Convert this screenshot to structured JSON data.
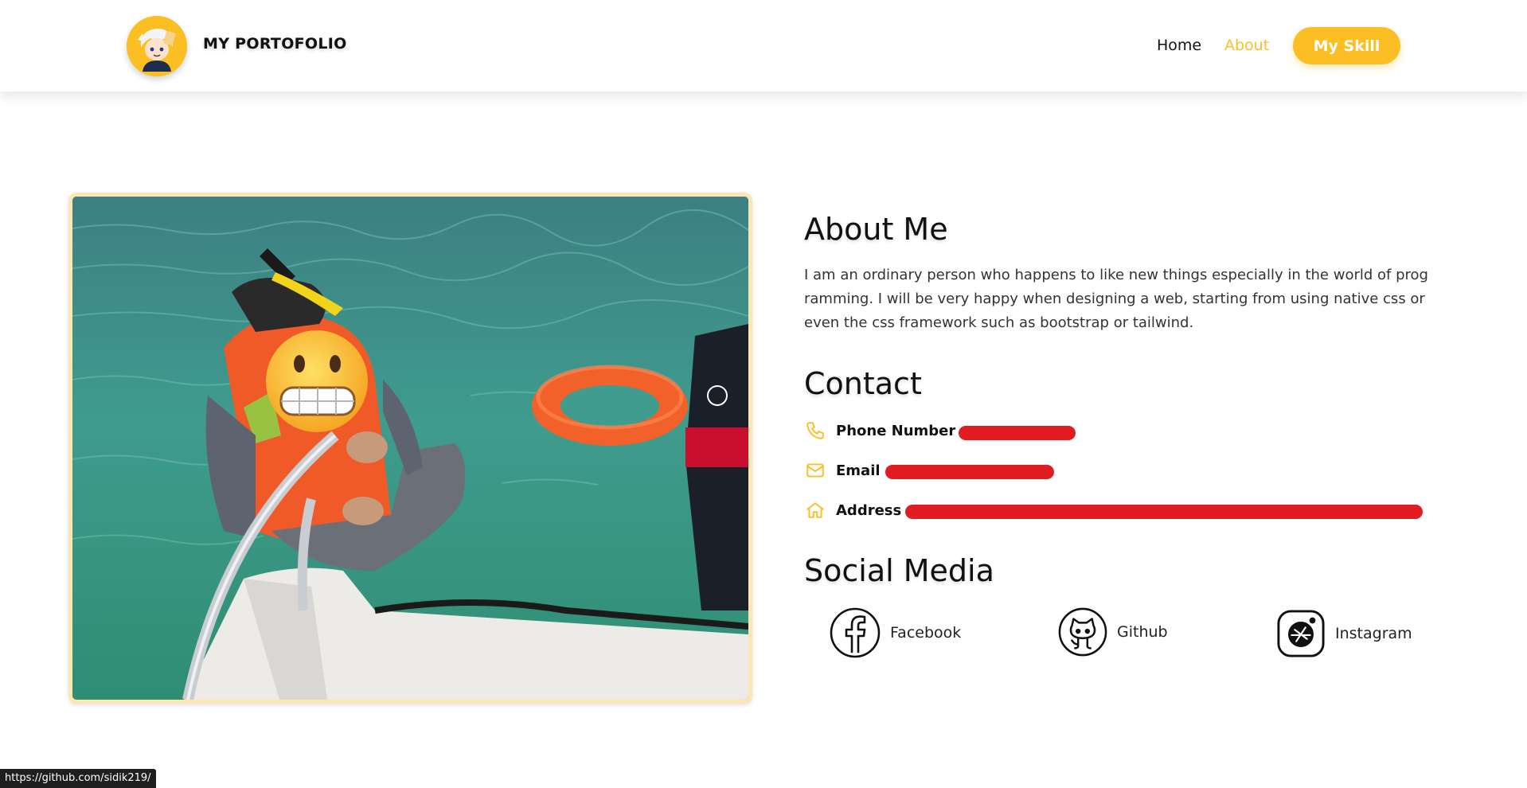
{
  "header": {
    "brand_title": "MY PORTOFOLIO",
    "logo_icon": "anime-character-avatar",
    "nav": {
      "home": "Home",
      "about": "About",
      "skill": "My Skill"
    },
    "active_nav": "About"
  },
  "about": {
    "heading": "About Me",
    "text": "I am an ordinary person who happens to like new things especially in the world of programming. I will be very happy when designing a web, starting from using native css or even the css framework such as bootstrap or tailwind."
  },
  "contact": {
    "heading": "Contact",
    "phone_label": "Phone Number :",
    "email_label": "Email :",
    "address_label": "Address :"
  },
  "social": {
    "heading": "Social Media",
    "items": [
      {
        "label": "Facebook",
        "icon": "facebook-icon"
      },
      {
        "label": "Github",
        "icon": "github-icon"
      },
      {
        "label": "Instagram",
        "icon": "instagram-icon"
      }
    ]
  },
  "status_bar": {
    "url": "https://github.com/sidik219/"
  },
  "colors": {
    "accent": "#fbbf24",
    "redaction": "#e11d22",
    "photo_border": "#fce7b3"
  }
}
